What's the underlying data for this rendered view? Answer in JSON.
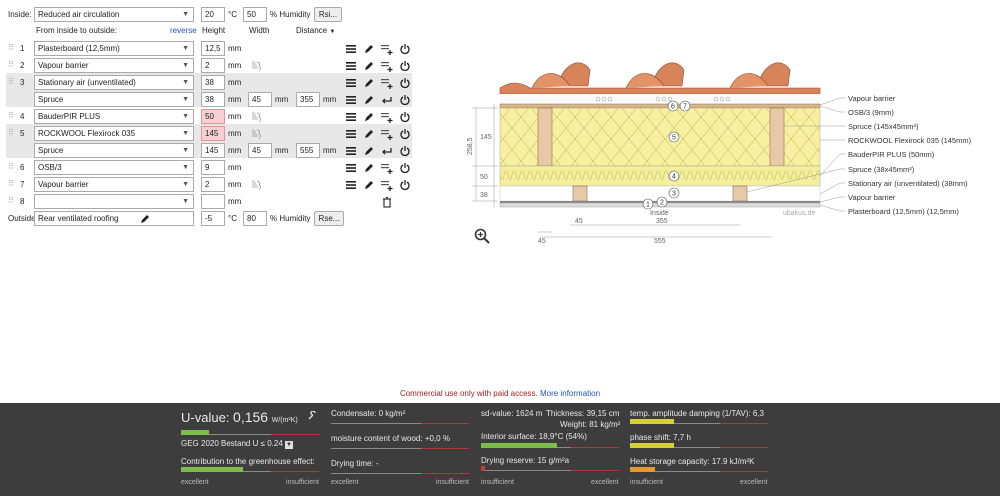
{
  "inside": {
    "label": "Inside:",
    "climate": "Reduced air circulation",
    "temp": "20",
    "temp_unit": "°C",
    "humidity": "50",
    "humidity_unit": "% Humidity",
    "rsi_button": "Rsi..."
  },
  "headers": {
    "from_inside": "From inside to outside:",
    "reverse": "reverse",
    "height": "Height",
    "width": "Width",
    "distance": "Distance"
  },
  "layers": [
    {
      "num": "1",
      "material": "Plasterboard (12,5mm)",
      "height": "12,5",
      "unit": "mm"
    },
    {
      "num": "2",
      "material": "Vapour barrier",
      "height": "2",
      "unit": "mm"
    },
    {
      "num": "3",
      "material": "Stationary air (unventilated)",
      "height": "38",
      "unit": "mm",
      "sub": {
        "material": "Spruce",
        "height": "38",
        "width": "45",
        "distance": "355"
      }
    },
    {
      "num": "4",
      "material": "BauderPIR PLUS",
      "height": "50",
      "unit": "mm"
    },
    {
      "num": "5",
      "material": "ROCKWOOL Flexirock 035",
      "height": "145",
      "unit": "mm",
      "sub": {
        "material": "Spruce",
        "height": "145",
        "width": "45",
        "distance": "555"
      }
    },
    {
      "num": "6",
      "material": "OSB/3",
      "height": "9",
      "unit": "mm"
    },
    {
      "num": "7",
      "material": "Vapour barrier",
      "height": "2",
      "unit": "mm"
    },
    {
      "num": "8",
      "material": "",
      "height": "",
      "unit": "mm"
    }
  ],
  "outside": {
    "label": "Outside",
    "climate": "Rear ventilated roofing",
    "temp": "-5",
    "temp_unit": "°C",
    "humidity": "80",
    "humidity_unit": "% Humidity",
    "rse_button": "Rse..."
  },
  "mm": "mm",
  "diagram": {
    "labels": [
      "Vapour barrier",
      "OSB/3 (9mm)",
      "Spruce (145x45mm²)",
      "ROCKWOOL Flexirock 035 (145mm)",
      "BauderPIR PLUS (50mm)",
      "Spruce (38x45mm²)",
      "Stationary air (unventilated) (38mm)",
      "Vapour barrier",
      "Plasterboard (12,5mm) (12,5mm)"
    ],
    "dim_total": "258,5",
    "dim_145": "145",
    "dim_50": "50",
    "dim_38": "38",
    "dim_45a": "45",
    "dim_355": "355",
    "dim_45b": "45",
    "dim_555": "555",
    "inside_label": "Inside",
    "watermark": "ubakus.de",
    "markers": [
      "1",
      "2",
      "3",
      "4",
      "5",
      "6",
      "7"
    ]
  },
  "notice": {
    "text": "Commercial use only with paid access.",
    "link": "More information"
  },
  "results": {
    "uvalue_label": "U-value:",
    "uvalue": "0,156",
    "uvalue_unit": "W/(m²K)",
    "geg": "GEG 2020 Bestand U ≤ 0.24",
    "greenhouse": "Contribution to the greenhouse effect:",
    "excellent": "excellent",
    "insufficient": "insufficient",
    "condensate": "Condensate: 0 kg/m²",
    "moisture": "moisture content of wood: +0,0 %",
    "drying": "Drying time: -",
    "sd_value": "sd-value: 1624 m",
    "thickness": "Thickness: 39,15 cm",
    "weight": "Weight: 81 kg/m²",
    "interior_surface": "Interior surface: 18,9°C (54%)",
    "drying_reserve": "Drying reserve: 15 g/m²a",
    "temp_amp": "temp. amplitude damping (1/TAV): 6,3",
    "phase_shift": "phase shift: 7,7 h",
    "heat_storage": "Heat storage capacity: 17.9 kJ/m²K",
    "levels": {
      "uvalue": 0.2,
      "greenhouse": 0.45,
      "condensate": 0.0,
      "moisture": 0.0,
      "drying": 0.0,
      "sd": 0.0,
      "interior": 0.55,
      "reserve": 0.03,
      "temp_amp": 0.32,
      "phase": 0.32,
      "heat": 0.18
    }
  },
  "colors": {
    "insulation": "#f6f0a0",
    "wood": "#e8c9a6",
    "roof": "#d8845a",
    "bar_green": "#7dbd4a",
    "bar_yellow": "#d6d236",
    "bar_orange": "#e69a2b",
    "bar_red": "#c93b3b"
  }
}
